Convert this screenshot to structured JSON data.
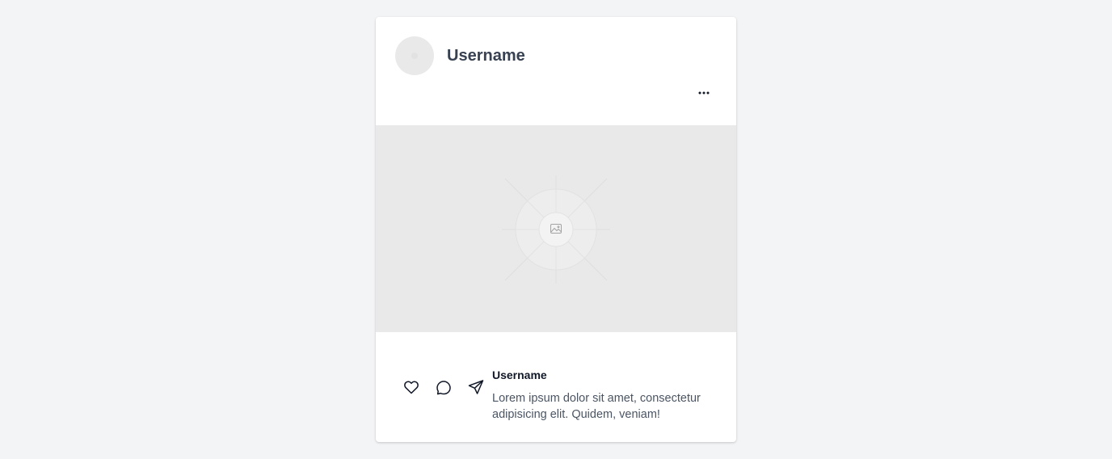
{
  "post": {
    "header": {
      "username": "Username",
      "avatar_icon": "avatar-placeholder",
      "more_icon": "more-horizontal-icon"
    },
    "media": {
      "icon": "image-placeholder-icon"
    },
    "actions": [
      {
        "name": "like",
        "icon": "heart-icon"
      },
      {
        "name": "comment",
        "icon": "comment-icon"
      },
      {
        "name": "share",
        "icon": "send-icon"
      }
    ],
    "caption": {
      "username": "Username",
      "text": "Lorem ipsum dolor sit amet, consectetur adipisicing elit. Quidem, veniam!"
    }
  },
  "colors": {
    "background": "#f3f4f6",
    "card": "#ffffff",
    "placeholder": "#e9e9e9",
    "header_text": "#374151",
    "caption_user": "#111827",
    "caption_text": "#4b5563"
  }
}
